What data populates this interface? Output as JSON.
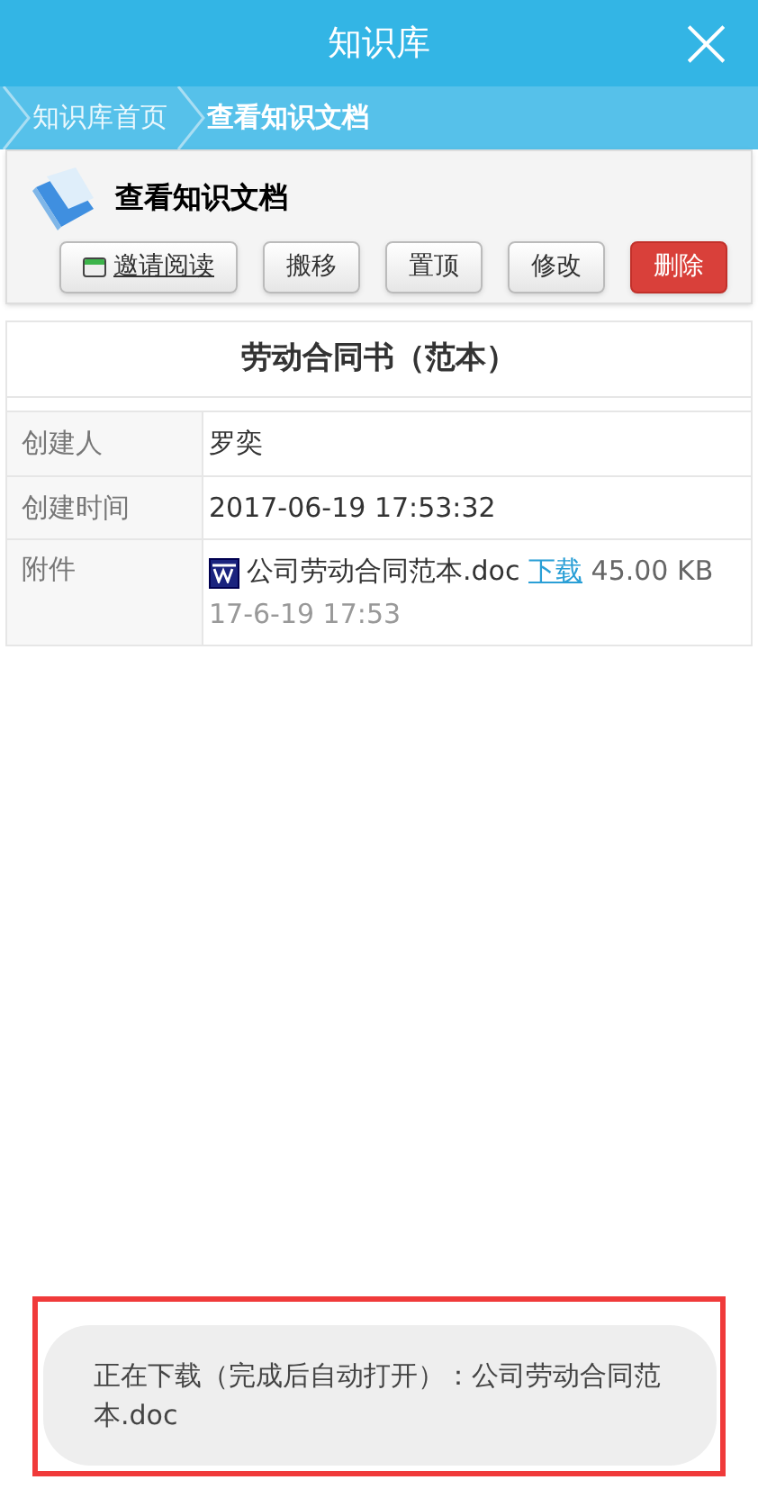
{
  "header": {
    "title": "知识库",
    "close": "×"
  },
  "breadcrumbs": [
    {
      "label": "知识库首页",
      "selected": false
    },
    {
      "label": "查看知识文档",
      "selected": true
    }
  ],
  "panel": {
    "title": "查看知识文档",
    "buttons": [
      {
        "label": "邀请阅读",
        "kind": "invite"
      },
      {
        "label": "搬移",
        "kind": "normal"
      },
      {
        "label": "置顶",
        "kind": "normal"
      },
      {
        "label": "修改",
        "kind": "normal"
      },
      {
        "label": "删除",
        "kind": "danger"
      }
    ]
  },
  "document": {
    "title": "劳动合同书（范本）",
    "fields": [
      {
        "label": "创建人",
        "kind": "text",
        "value": "罗奕"
      },
      {
        "label": "创建时间",
        "kind": "text",
        "value": "2017-06-19 17:53:32"
      },
      {
        "label": "附件",
        "kind": "attachment",
        "file": "公司劳动合同范本.doc",
        "link": "下载",
        "size": "45.00 KB",
        "date": "17-6-19 17:53"
      }
    ]
  },
  "toast": {
    "message": "正在下载（完成后自动打开）：公司劳动合同范本.doc",
    "highlighted": true
  }
}
